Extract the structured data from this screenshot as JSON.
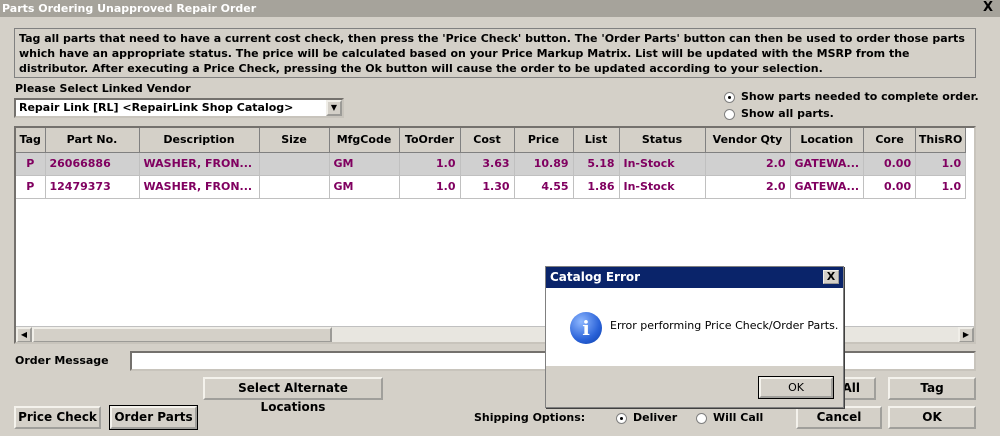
{
  "window": {
    "title": "Parts Ordering Unapproved Repair Order",
    "close_glyph": "X"
  },
  "instructions": "Tag all parts that need to have a current cost check, then press the 'Price Check' button.  The 'Order Parts' button can then be used to order those parts which have an appropriate status.  The price will be calculated based on your Price Markup Matrix. List will be updated with the MSRP from the distributor.  After executing a Price Check, pressing the Ok button will cause the order to be updated according to your selection.",
  "vendor": {
    "label": "Please Select Linked Vendor",
    "selected": "Repair Link [RL] <RepairLink Shop Catalog>"
  },
  "show_options": {
    "needed": "Show parts needed to complete order.",
    "all": "Show all parts.",
    "selected": "needed"
  },
  "grid": {
    "columns": [
      "Tag",
      "Part No.",
      "Description",
      "Size",
      "MfgCode",
      "ToOrder",
      "Cost",
      "Price",
      "List",
      "Status",
      "Vendor Qty",
      "Location",
      "Core",
      "ThisRO"
    ],
    "rows": [
      {
        "tag": "P",
        "part_no": "26066886",
        "description": "WASHER, FRON...",
        "size": "",
        "mfg": "GM",
        "to_order": "1.0",
        "cost": "3.63",
        "price": "10.89",
        "list": "5.18",
        "status": "In-Stock",
        "vendor_qty": "2.0",
        "location": "GATEWA...",
        "core": "0.00",
        "this_ro": "1.0"
      },
      {
        "tag": "P",
        "part_no": "12479373",
        "description": "WASHER, FRON...",
        "size": "",
        "mfg": "GM",
        "to_order": "1.0",
        "cost": "1.30",
        "price": "4.55",
        "list": "1.86",
        "status": "In-Stock",
        "vendor_qty": "2.0",
        "location": "GATEWA...",
        "core": "0.00",
        "this_ro": "1.0"
      }
    ]
  },
  "order_message": {
    "label": "Order Message",
    "value": ""
  },
  "buttons": {
    "alternate_locations": "Select Alternate Locations",
    "all": "All",
    "tag": "Tag",
    "price_check": "Price Check",
    "order_parts": "Order Parts",
    "cancel": "Cancel",
    "ok": "OK"
  },
  "shipping": {
    "label": "Shipping Options:",
    "deliver": "Deliver",
    "will_call": "Will Call",
    "selected": "deliver"
  },
  "dialog": {
    "title": "Catalog Error",
    "close_glyph": "X",
    "icon_glyph": "i",
    "message": "Error performing Price Check/Order Parts.",
    "ok": "OK"
  },
  "scroll": {
    "left_glyph": "◀",
    "right_glyph": "▶",
    "dropdown_glyph": "▼"
  }
}
